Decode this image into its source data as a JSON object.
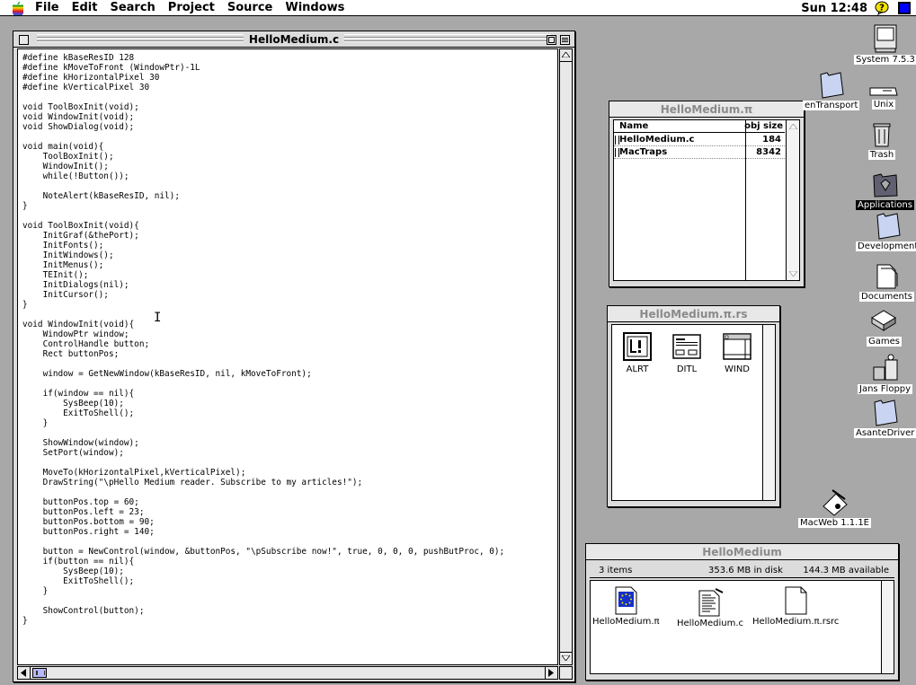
{
  "menubar": {
    "items": [
      "File",
      "Edit",
      "Search",
      "Project",
      "Source",
      "Windows"
    ],
    "clock": "Sun 12:48"
  },
  "editor": {
    "title": "HelloMedium.c",
    "code": "#define kBaseResID 128\n#define kMoveToFront (WindowPtr)-1L\n#define kHorizontalPixel 30\n#define kVerticalPixel 30\n\nvoid ToolBoxInit(void);\nvoid WindowInit(void);\nvoid ShowDialog(void);\n\nvoid main(void){\n    ToolBoxInit();\n    WindowInit();\n    while(!Button());\n\n    NoteAlert(kBaseResID, nil);\n}\n\nvoid ToolBoxInit(void){\n    InitGraf(&thePort);\n    InitFonts();\n    InitWindows();\n    InitMenus();\n    TEInit();\n    InitDialogs(nil);\n    InitCursor();\n}\n\nvoid WindowInit(void){\n    WindowPtr window;\n    ControlHandle button;\n    Rect buttonPos;\n\n    window = GetNewWindow(kBaseResID, nil, kMoveToFront);\n\n    if(window == nil){\n        SysBeep(10);\n        ExitToShell();\n    }\n\n    ShowWindow(window);\n    SetPort(window);\n\n    MoveTo(kHorizontalPixel,kVerticalPixel);\n    DrawString(\"\\pHello Medium reader. Subscribe to my articles!\");\n\n    buttonPos.top = 60;\n    buttonPos.left = 23;\n    buttonPos.bottom = 90;\n    buttonPos.right = 140;\n\n    button = NewControl(window, &buttonPos, \"\\pSubscribe now!\", true, 0, 0, 0, pushButProc, 0);\n    if(button == nil){\n        SysBeep(10);\n        ExitToShell();\n    }\n\n    ShowControl(button);\n}"
  },
  "project": {
    "title": "HelloMedium.π",
    "col_name": "Name",
    "col_size": "obj size",
    "rows": [
      {
        "name": "HelloMedium.c",
        "size": "184"
      },
      {
        "name": "MacTraps",
        "size": "8342"
      }
    ]
  },
  "resources": {
    "title": "HelloMedium.π.rs",
    "items": [
      {
        "label": "ALRT",
        "icon": "alert-resource-icon"
      },
      {
        "label": "DITL",
        "icon": "dialog-items-resource-icon"
      },
      {
        "label": "WIND",
        "icon": "window-resource-icon"
      }
    ]
  },
  "folder": {
    "title": "HelloMedium",
    "items_count": "3 items",
    "disk_usage": "353.6 MB in disk",
    "available": "144.3 MB available",
    "files": [
      {
        "label": "HelloMedium.π",
        "icon": "project-file-icon"
      },
      {
        "label": "HelloMedium.c",
        "icon": "source-file-icon"
      },
      {
        "label": "HelloMedium.π.rsrc",
        "icon": "resource-file-icon"
      }
    ]
  },
  "desktop": {
    "icons": [
      {
        "label": "System 7.5.3",
        "icon": "hard-disk-icon"
      },
      {
        "label": "enTransport",
        "icon": "folder-icon"
      },
      {
        "label": "Unix",
        "icon": "drive-icon"
      },
      {
        "label": "Trash",
        "icon": "trash-icon"
      },
      {
        "label": "Applications",
        "icon": "applications-folder-icon"
      },
      {
        "label": "Development",
        "icon": "folder-icon"
      },
      {
        "label": "Documents",
        "icon": "documents-folder-icon"
      },
      {
        "label": "Games",
        "icon": "games-icon"
      },
      {
        "label": "Jans Floppy",
        "icon": "floppy-icon"
      },
      {
        "label": "AsanteDriver",
        "icon": "folder-icon"
      },
      {
        "label": "MacWeb 1.1.1E",
        "icon": "macweb-app-icon"
      }
    ]
  },
  "colors": {
    "desktop": "#a8a8a8",
    "window_frame": "#dcdcdc",
    "selection": "#000000",
    "accent_blue": "#0000ff"
  }
}
